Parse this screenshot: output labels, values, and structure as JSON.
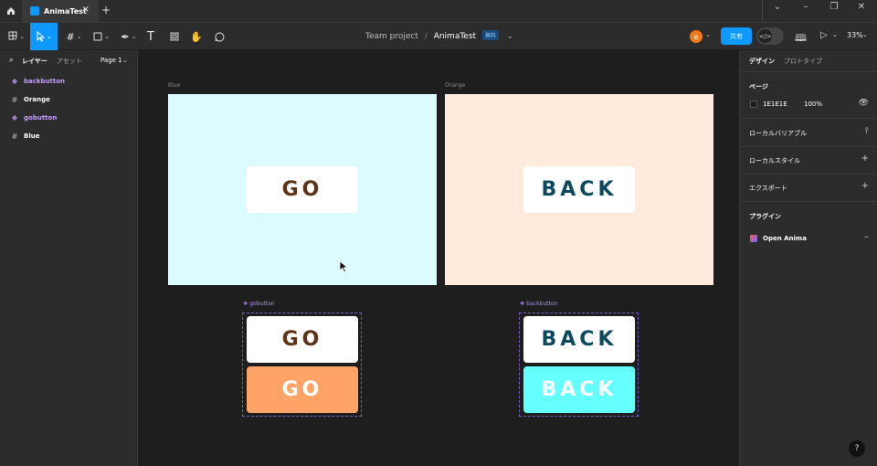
{
  "titlebar": {
    "tab_title": "AnimaTest",
    "close": "×",
    "new_tab": "+"
  },
  "toolbar": {
    "breadcrumb_project": "Team project",
    "breadcrumb_sep": "/",
    "file_name": "AnimaTest",
    "plan_badge": "無料",
    "avatar_initial": "e",
    "share_label": "共有",
    "zoom": "33%"
  },
  "left_panel": {
    "tabs": {
      "layers": "レイヤー",
      "assets": "アセット",
      "page": "Page 1"
    },
    "layers": [
      {
        "name": "backbutton",
        "kind": "component"
      },
      {
        "name": "Orange",
        "kind": "frame"
      },
      {
        "name": "gobutton",
        "kind": "component"
      },
      {
        "name": "Blue",
        "kind": "frame"
      }
    ]
  },
  "right_panel": {
    "tabs": {
      "design": "デザイン",
      "prototype": "プロトタイプ"
    },
    "page_section": {
      "title": "ページ",
      "color": "1E1E1E",
      "opacity": "100%"
    },
    "local_variables": "ローカルバリアブル",
    "local_styles": "ローカルスタイル",
    "export": "エクスポート",
    "plugins": {
      "title": "プラグイン",
      "item": "Open Anima"
    }
  },
  "canvas": {
    "frames": [
      {
        "label": "Blue",
        "bg": "#dbfbff",
        "button": {
          "text": "GO",
          "color": "#5e3418"
        }
      },
      {
        "label": "Orange",
        "bg": "#ffeadb",
        "button": {
          "text": "BACK",
          "color": "#0e4a5e"
        }
      }
    ],
    "components": [
      {
        "label": "gobutton",
        "variants": [
          {
            "text": "GO",
            "bg": "#ffffff",
            "color": "#5e3418"
          },
          {
            "text": "GO",
            "bg": "#ffa466",
            "color": "#ffffff"
          }
        ]
      },
      {
        "label": "backbutton",
        "variants": [
          {
            "text": "BACK",
            "bg": "#ffffff",
            "color": "#0e4a5e"
          },
          {
            "text": "BACK",
            "bg": "#66ffff",
            "color": "#ffffff"
          }
        ]
      }
    ]
  },
  "help": "?"
}
